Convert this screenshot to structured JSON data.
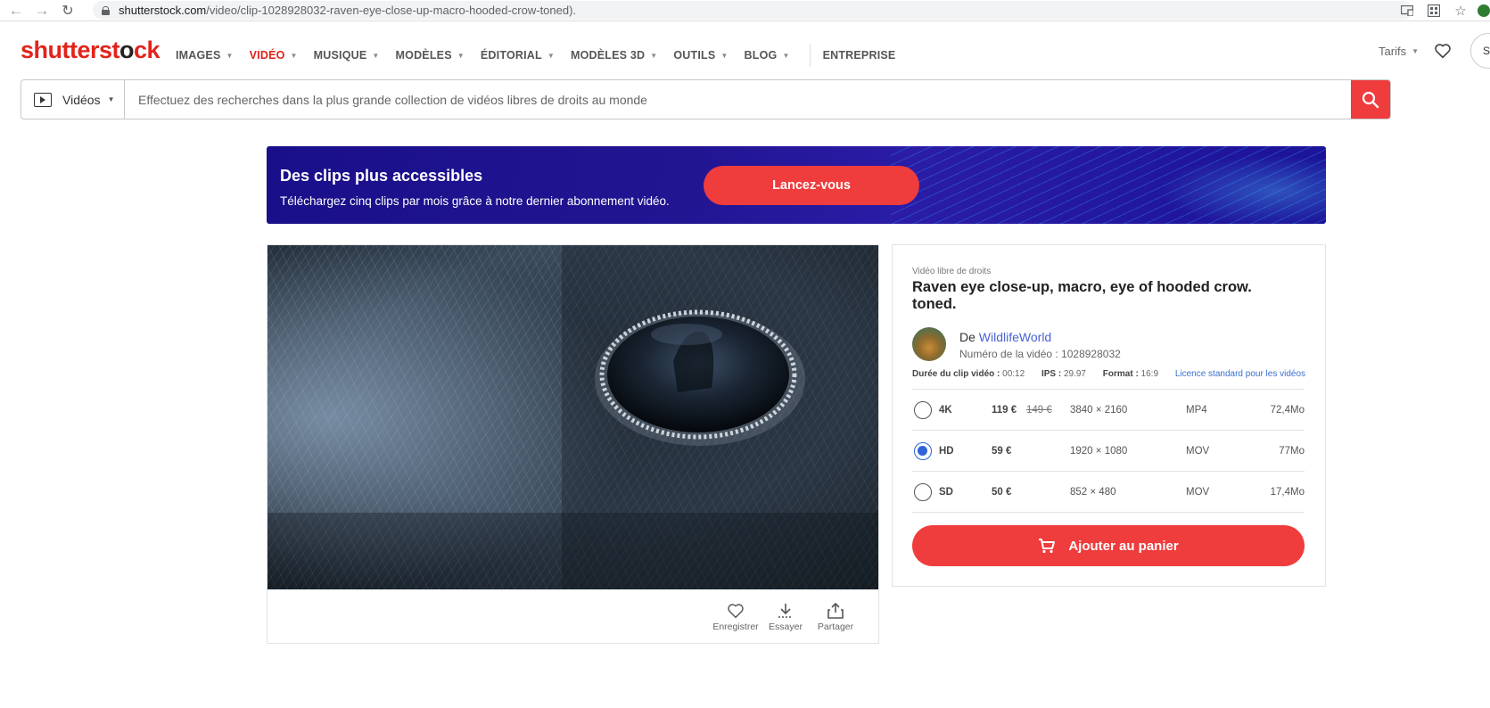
{
  "browser": {
    "url_host": "shutterstock.com",
    "url_path": "/video/clip-1028928032-raven-eye-close-up-macro-hooded-crow-toned)."
  },
  "header": {
    "logo_main": "shutterst",
    "logo_o": "o",
    "logo_end": "ck",
    "nav": [
      {
        "label": "IMAGES",
        "caret": true
      },
      {
        "label": "VIDÉO",
        "caret": true,
        "active": true
      },
      {
        "label": "MUSIQUE",
        "caret": true
      },
      {
        "label": "MODÈLES",
        "caret": true
      },
      {
        "label": "ÉDITORIAL",
        "caret": true
      },
      {
        "label": "MODÈLES 3D",
        "caret": true
      },
      {
        "label": "OUTILS",
        "caret": true
      },
      {
        "label": "BLOG",
        "caret": true
      }
    ],
    "enterprise": "ENTREPRISE",
    "pricing": "Tarifs",
    "signin_initial": "S"
  },
  "search": {
    "type_label": "Vidéos",
    "placeholder": "Effectuez des recherches dans la plus grande collection de vidéos libres de droits au monde"
  },
  "banner": {
    "title": "Des clips plus accessibles",
    "subtitle": "Téléchargez cinq clips par mois grâce à notre dernier abonnement vidéo.",
    "cta": "Lancez-vous"
  },
  "video_actions": {
    "save": "Enregistrer",
    "try": "Essayer",
    "share": "Partager"
  },
  "clip": {
    "royalty": "Vidéo libre de droits",
    "title": "Raven eye close-up, macro, eye of hooded crow. toned.",
    "by": "De",
    "author": "WildlifeWorld",
    "clip_id": "Numéro de la vidéo : 1028928032",
    "duration_label": "Durée du clip vidéo :",
    "duration": "00:12",
    "fps_label": "IPS :",
    "fps": "29.97",
    "format_label": "Format :",
    "format": "16:9",
    "license": "Licence standard pour les vidéos"
  },
  "options": [
    {
      "res": "4K",
      "price": "119 €",
      "old_price": "149 €",
      "dims": "3840 × 2160",
      "fmt": "MP4",
      "size": "72,4Mo",
      "checked": false
    },
    {
      "res": "HD",
      "price": "59 €",
      "old_price": "",
      "dims": "1920 × 1080",
      "fmt": "MOV",
      "size": "77Mo",
      "checked": true
    },
    {
      "res": "SD",
      "price": "50 €",
      "old_price": "",
      "dims": "852 × 480",
      "fmt": "MOV",
      "size": "17,4Mo",
      "checked": false
    }
  ],
  "cart": {
    "label": "Ajouter au panier"
  },
  "colors": {
    "brand_red": "#ef3c3d",
    "link_blue": "#4a60d4",
    "banner_blue": "#221592"
  }
}
